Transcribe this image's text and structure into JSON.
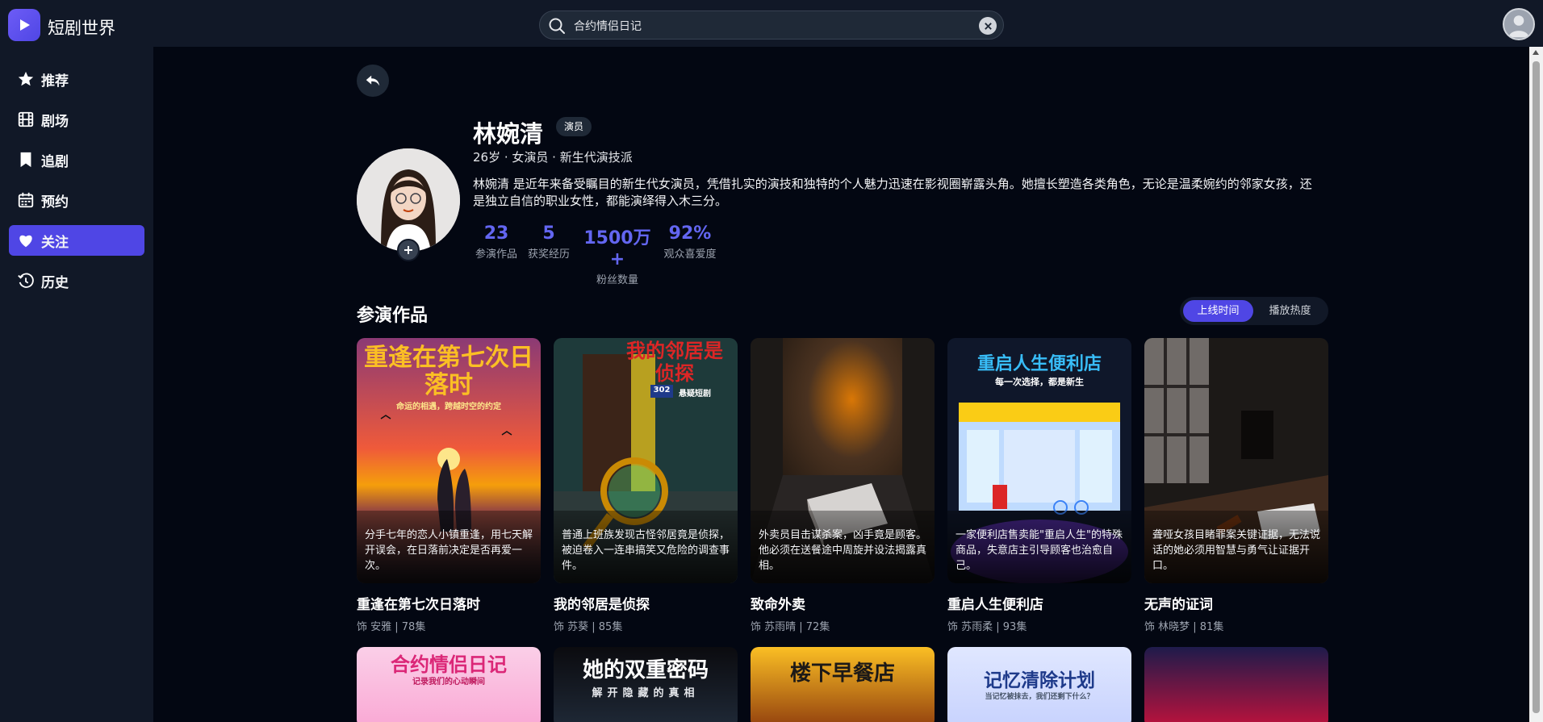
{
  "header": {
    "brand": "短剧世界",
    "search": {
      "value": "合约情侣日记",
      "placeholder": ""
    }
  },
  "sidebar": {
    "items": [
      {
        "label": "推荐",
        "icon": "star-icon",
        "active": false
      },
      {
        "label": "剧场",
        "icon": "film-icon",
        "active": false
      },
      {
        "label": "追剧",
        "icon": "bookmark-icon",
        "active": false
      },
      {
        "label": "预约",
        "icon": "calendar-icon",
        "active": false
      },
      {
        "label": "关注",
        "icon": "heart-icon",
        "active": true
      },
      {
        "label": "历史",
        "icon": "history-icon",
        "active": false
      }
    ]
  },
  "actor": {
    "name": "林婉清",
    "badge": "演员",
    "meta": "26岁 · 女演员 · 新生代演技派",
    "bio": "林婉清 是近年来备受瞩目的新生代女演员，凭借扎实的演技和独特的个人魅力迅速在影视圈崭露头角。她擅长塑造各类角色，无论是温柔婉约的邻家女孩，还是独立自信的职业女性，都能演绎得入木三分。",
    "stats": [
      {
        "value": "23",
        "label": "参演作品"
      },
      {
        "value": "5",
        "label": "获奖经历"
      },
      {
        "value": "1500万+",
        "label": "粉丝数量"
      },
      {
        "value": "92%",
        "label": "观众喜爱度"
      }
    ]
  },
  "works": {
    "title": "参演作品",
    "sort": {
      "options": [
        "上线时间",
        "播放热度"
      ],
      "selected": "上线时间"
    },
    "items": [
      {
        "title": "重逢在第七次日落时",
        "cover_text": "重逢在第七次日落时",
        "cover_subtext": "命运的相遇，跨越时空的约定",
        "desc": "分手七年的恋人小镇重逢，用七天解开误会，在日落前决定是否再爱一次。",
        "sub": "饰 安雅 | 78集"
      },
      {
        "title": "我的邻居是侦探",
        "cover_text": "我的邻居是侦探",
        "cover_subtext": "悬疑短剧",
        "door_number": "302",
        "desc": "普通上班族发现古怪邻居竟是侦探，被迫卷入一连串搞笑又危险的调查事件。",
        "sub": "饰 苏葵 | 85集"
      },
      {
        "title": "致命外卖",
        "desc": "外卖员目击谋杀案，凶手竟是顾客。他必须在送餐途中周旋并设法揭露真相。",
        "sub": "饰 苏雨晴 | 72集"
      },
      {
        "title": "重启人生便利店",
        "cover_text": "重启人生便利店",
        "cover_subtext": "每一次选择，都是新生",
        "desc": "一家便利店售卖能\"重启人生\"的特殊商品，失意店主引导顾客也治愈自己。",
        "sub": "饰 苏雨柔 | 93集"
      },
      {
        "title": "无声的证词",
        "desc": "聋哑女孩目睹罪案关键证据，无法说话的她必须用智慧与勇气让证据开口。",
        "sub": "饰 林晓梦 | 81集"
      }
    ],
    "second_row": [
      {
        "cover_text": "合约情侣日记",
        "cover_subtext": "记录我们的心动瞬间"
      },
      {
        "cover_text": "她的双重密码",
        "cover_subtext": "解开隐藏的真相"
      },
      {
        "cover_text": "楼下早餐店"
      },
      {
        "cover_text": "记忆清除计划",
        "cover_subtext": "当记忆被抹去，我们还剩下什么？"
      },
      {
        "cover_text": ""
      }
    ]
  },
  "colors": {
    "accent": "#4f46e5",
    "stat": "#6366f1",
    "bg": "#030712",
    "panel": "#111827"
  }
}
